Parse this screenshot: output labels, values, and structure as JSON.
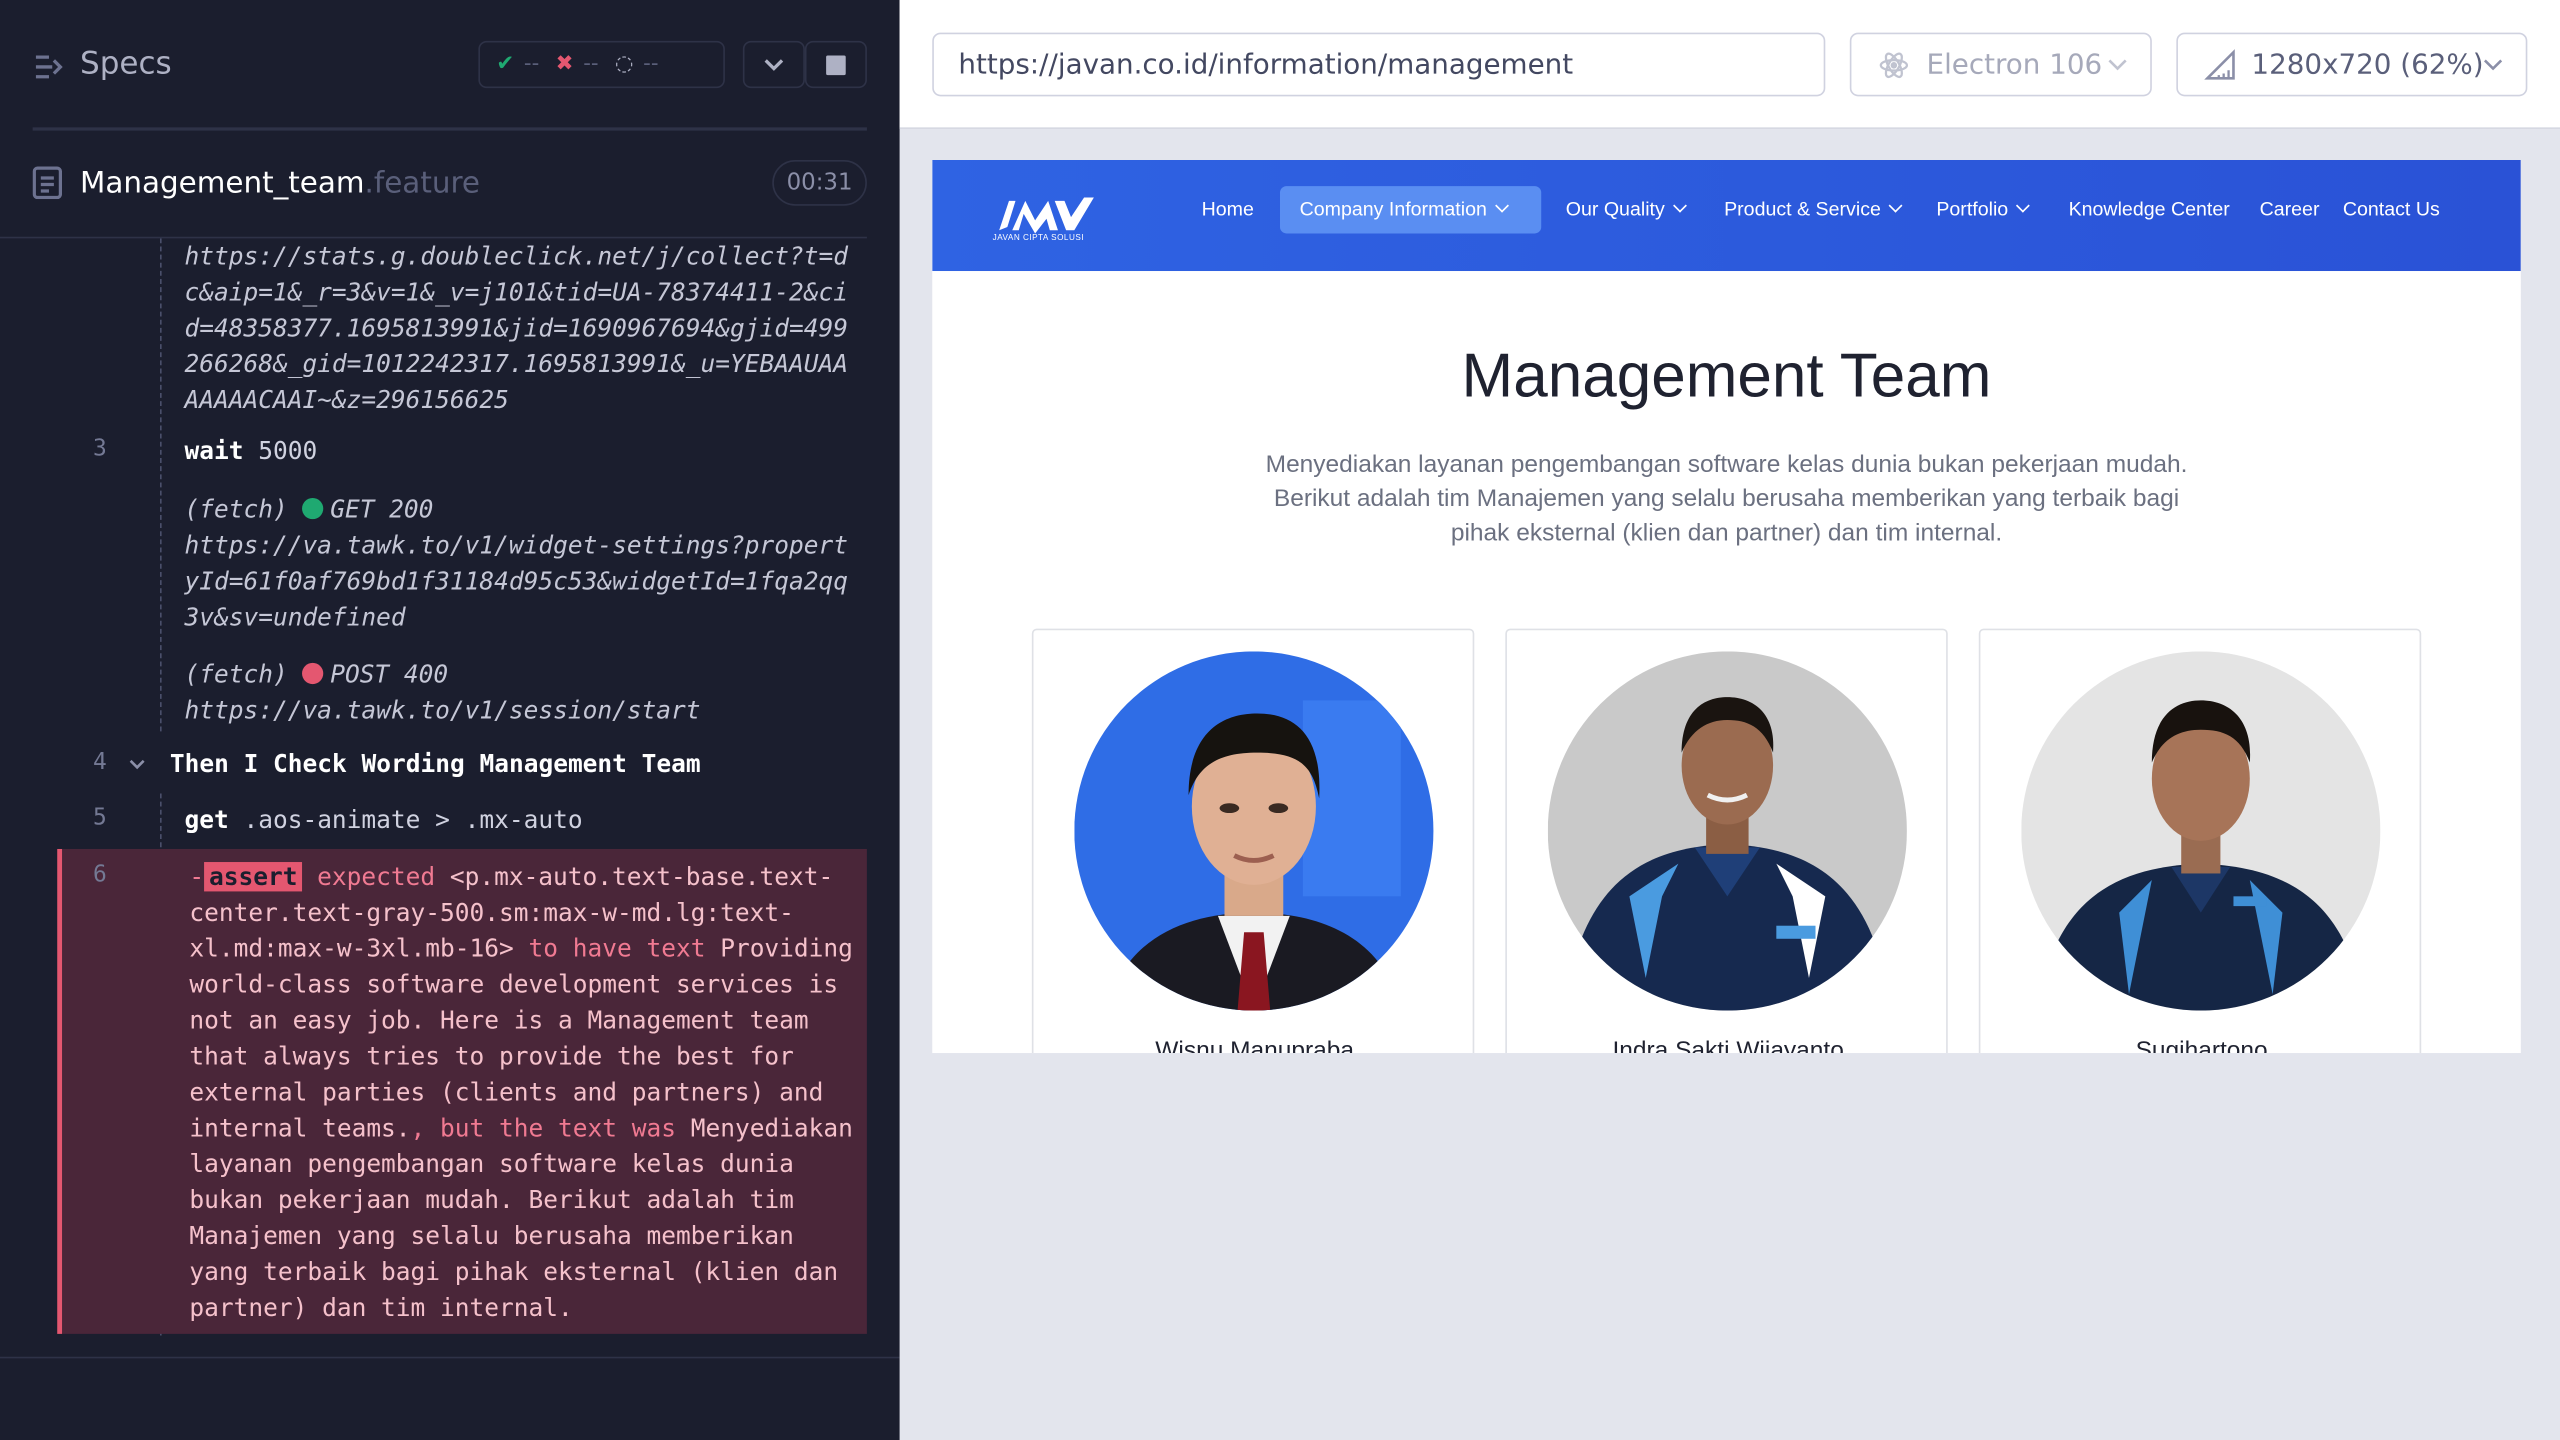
{
  "reporter": {
    "title": "Specs",
    "stats": {
      "passed": "--",
      "failed": "--",
      "pending": "--"
    },
    "spec": {
      "name": "Management_team",
      "ext": ".feature",
      "duration": "00:31"
    },
    "log": {
      "url1": "https://stats.g.doubleclick.net/j/collect?t=dc&aip=1&_r=3&v=1&_v=j101&tid=UA-78374411-2&cid=48358377.1695813991&jid=1690967694&gjid=499266268&_gid=1012242317.1695813991&_u=YEBAAUAAAAAAACAAI~&z=296156625",
      "step3": {
        "num": "3",
        "cmd": "wait",
        "arg": "5000"
      },
      "fetch1": {
        "label": "(fetch)",
        "status": "GET 200",
        "url": "https://va.tawk.to/v1/widget-settings?propertyId=61f0af769bd1f31184d95c53&widgetId=1fqa2qq3v&sv=undefined",
        "color": "#1fa971"
      },
      "fetch2": {
        "label": "(fetch)",
        "status": "POST 400",
        "url": "https://va.tawk.to/v1/session/start",
        "color": "#e45770"
      },
      "step4": {
        "num": "4",
        "kw": "Then",
        "text": "I Check Wording Management Team"
      },
      "step5": {
        "num": "5",
        "cmd": "get",
        "arg": ".aos-animate > .mx-auto"
      },
      "step6": {
        "num": "6",
        "prefix": "-",
        "cmd": "assert",
        "expected_word": "expected",
        "selector": "<p.mx-auto.text-base.text-center.text-gray-500.sm:max-w-md.lg:text-xl.md:max-w-3xl.mb-16>",
        "to_have_text": "to have text",
        "expected_text": "Providing world-class software development services is not an easy job. Here is a Management team that always tries to provide the best for external parties (clients and partners) and internal teams.",
        "but_was": ", but the text was",
        "actual_text": "Menyediakan layanan pengembangan software kelas dunia bukan pekerjaan mudah. Berikut adalah tim Manajemen yang selalu berusaha memberikan yang terbaik bagi pihak eksternal (klien dan partner) dan tim internal."
      }
    }
  },
  "runner": {
    "url": "https://javan.co.id/information/management",
    "browser": "Electron 106",
    "viewport": "1280x720  (62%)"
  },
  "site": {
    "logo_sub": "JAVAN CIPTA SOLUSI",
    "nav": [
      "Home",
      "Company Information",
      "Our Quality",
      "Product & Service",
      "Portfolio",
      "Knowledge Center",
      "Career",
      "Contact Us"
    ],
    "title": "Management Team",
    "description": "Menyediakan layanan pengembangan software kelas dunia bukan pekerjaan mudah. Berikut adalah tim Manajemen yang selalu berusaha memberikan yang terbaik bagi pihak eksternal (klien dan partner) dan tim internal.",
    "team": [
      {
        "name": "Wisnu Manupraba"
      },
      {
        "name": "Indra Sakti Wijayanto"
      },
      {
        "name": "Sugihartono"
      }
    ]
  }
}
